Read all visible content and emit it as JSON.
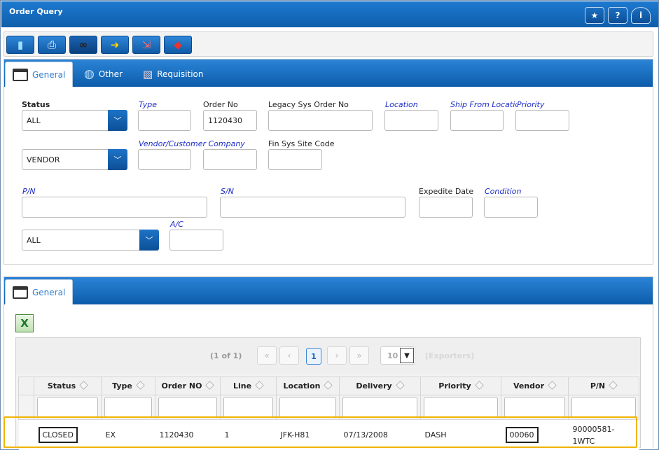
{
  "window": {
    "title": "Order Query"
  },
  "titlebar_buttons": [
    {
      "icon": "star-icon",
      "glyph": "★"
    },
    {
      "icon": "help-icon",
      "glyph": "?"
    },
    {
      "icon": "info-icon",
      "glyph": "i"
    }
  ],
  "toolbar": [
    {
      "icon": "new-document-icon",
      "glyph": "▮"
    },
    {
      "icon": "printer-icon",
      "glyph": "⎙"
    },
    {
      "icon": "binoculars-icon",
      "glyph": "∞"
    },
    {
      "icon": "arrow-icon",
      "glyph": "➜"
    },
    {
      "icon": "export-icon",
      "glyph": "⇲"
    },
    {
      "icon": "package-icon",
      "glyph": "◆"
    }
  ],
  "tabs_top": [
    {
      "label": "General",
      "icon": "window-icon",
      "active": true
    },
    {
      "label": "Other",
      "icon": "globe-icon",
      "active": false
    },
    {
      "label": "Requisition",
      "icon": "requisition-icon",
      "active": false
    }
  ],
  "form": {
    "status_label": "Status",
    "status_value": "ALL",
    "type_label": "Type",
    "type_value": "",
    "order_no_label": "Order No",
    "order_no_value": "1120430",
    "legacy_label": "Legacy Sys Order No",
    "legacy_value": "",
    "location_label": "Location",
    "location_value": "",
    "ship_from_label": "Ship From Location",
    "ship_from_value": "",
    "priority_label": "Priority",
    "priority_value": "",
    "party_value": "VENDOR",
    "vendor_company_label": "Vendor/Customer Company",
    "vendor_value": "",
    "company_value": "",
    "fin_sys_label": "Fin Sys Site Code",
    "fin_sys_value": "",
    "pn_label": "P/N",
    "pn_value": "",
    "sn_label": "S/N",
    "sn_value": "",
    "expedite_label": "Expedite Date",
    "expedite_value": "",
    "condition_label": "Condition",
    "condition_value": "",
    "ac_select_value": "ALL",
    "ac_label": "A/C",
    "ac_value": ""
  },
  "tabs_bottom": [
    {
      "label": "General",
      "icon": "window-icon",
      "active": true
    }
  ],
  "grid": {
    "pager": {
      "text": "(1 of 1)",
      "current_page": "1",
      "page_size": "10",
      "exporters": "[Exporters]"
    },
    "columns": [
      "Status",
      "Type",
      "Order NO",
      "Line",
      "Location",
      "Delivery",
      "Priority",
      "Vendor",
      "P/N"
    ],
    "rows": [
      {
        "status": "CLOSED",
        "type": "EX",
        "order_no": "1120430",
        "line": "1",
        "location": "JFK-H81",
        "delivery": "07/13/2008",
        "priority": "DASH",
        "vendor": "00060",
        "pn_line1": "90000581-",
        "pn_line2": "1WTC"
      }
    ]
  },
  "colors": {
    "header_blue": "#1466b8",
    "label_italic_blue": "#1e2dc9",
    "row_highlight": "#f0b400"
  }
}
